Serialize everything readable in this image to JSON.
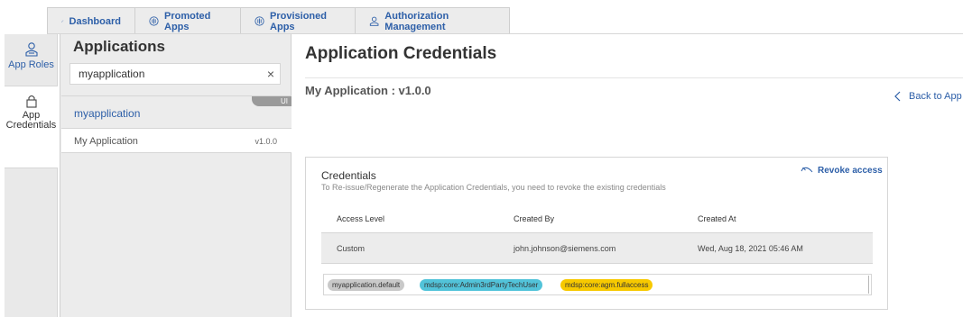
{
  "top_tabs": [
    {
      "label": "Dashboard",
      "icon": "pencil-icon"
    },
    {
      "label": "Promoted Apps",
      "icon": "app-icon"
    },
    {
      "label": "Provisioned Apps",
      "icon": "app-icon"
    },
    {
      "label": "Authorization Management",
      "icon": "user-icon"
    }
  ],
  "left_nav": {
    "roles_label": "App Roles",
    "creds_label_line1": "App",
    "creds_label_line2": "Credentials"
  },
  "apps_panel": {
    "title": "Applications",
    "search_value": "myapplication",
    "selected_app": "myapplication",
    "selected_badge": "UI",
    "list": [
      {
        "name": "My Application",
        "version": "v1.0.0"
      }
    ]
  },
  "main": {
    "title": "Application Credentials",
    "subtitle": "My Application : v1.0.0",
    "back_label": "Back to App",
    "credentials": {
      "title": "Credentials",
      "description": "To Re-issue/Regenerate the Application Credentials, you need to revoke the existing credentials",
      "revoke_label": "Revoke access",
      "columns": [
        "Access Level",
        "Created By",
        "Created At"
      ],
      "row": [
        "Custom",
        "john.johnson@siemens.com",
        "Wed, Aug 18, 2021 05:46 AM"
      ],
      "scopes": [
        {
          "label": "myapplication.default",
          "color": "#c9c9c9"
        },
        {
          "label": "mdsp:core:Admin3rdPartyTechUser",
          "color": "#52c3d9"
        },
        {
          "label": "mdsp:core:agm.fullaccess",
          "color": "#f7c900"
        }
      ]
    }
  },
  "colors": {
    "accent": "#2d5fa8",
    "panel_bg": "#ececec"
  }
}
